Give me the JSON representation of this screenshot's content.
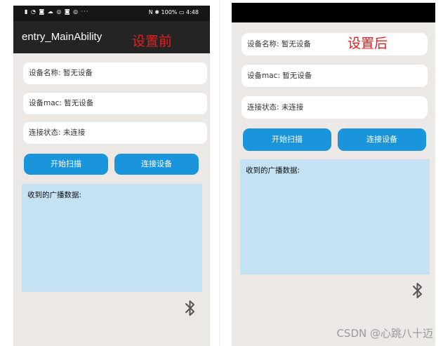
{
  "before": {
    "status_left": "▮ ◔ ◙ ☁ ◎ ◙ ◎ ···",
    "status_right": "N ✱ 100% ▭ 4:48",
    "app_title": "entry_MainAbility",
    "label": "设置前",
    "device_name": "设备名称:  暂无设备",
    "device_mac": "设备mac:  暂无设备",
    "connection_status": "连接状态:  未连接",
    "scan_button": "开始扫描",
    "connect_button": "连接设备",
    "broadcast_label": "收到的广播数据:"
  },
  "after": {
    "label": "设置后",
    "device_name": "设备名称:  暂无设备",
    "device_mac": "设备mac:  暂无设备",
    "connection_status": "连接状态:  未连接",
    "scan_button": "开始扫描",
    "connect_button": "连接设备",
    "broadcast_label": "收到的广播数据:"
  },
  "watermark": "CSDN @心跳八十迈",
  "colors": {
    "accent": "#1a95dc",
    "broadcast_bg": "#c4e2f4",
    "page_bg": "#ebe8e6",
    "label_red": "#e02020"
  }
}
